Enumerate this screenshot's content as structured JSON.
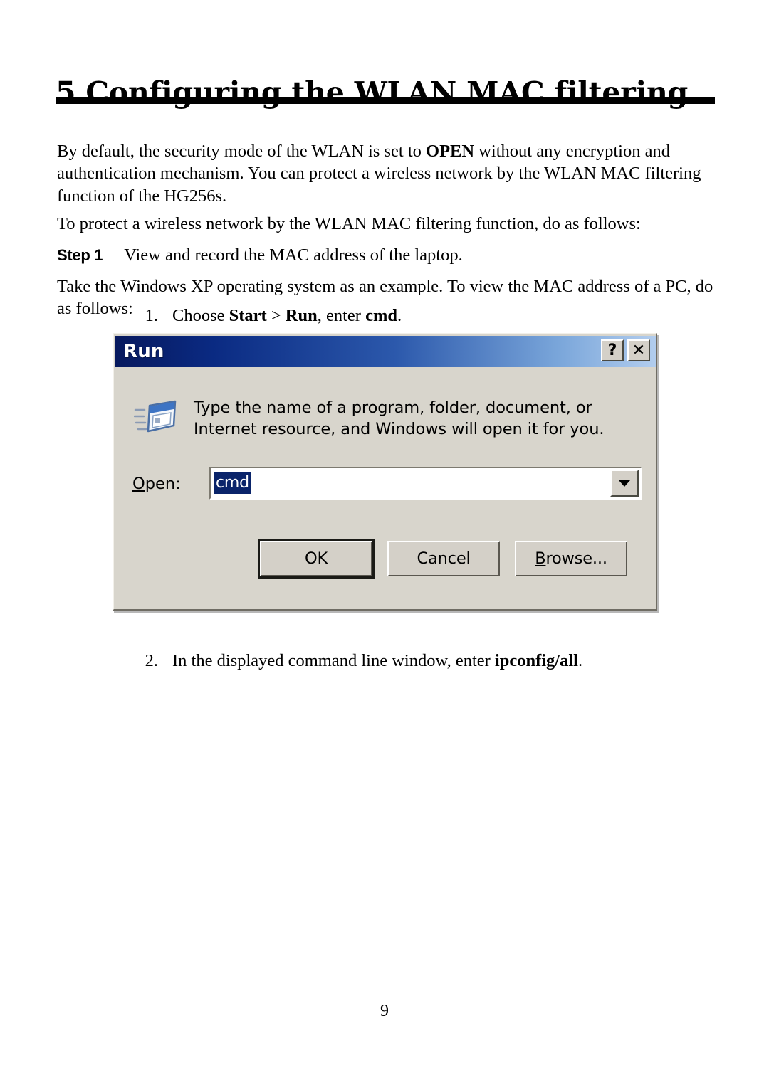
{
  "document": {
    "chapter_title": "5 Configuring the WLAN MAC filtering",
    "page_number": "9"
  },
  "paragraphs": {
    "intro_part1": "By default, the security mode of the WLAN is set to ",
    "intro_open": "OPEN",
    "intro_part2": " without any encryption and authentication mechanism. You can protect a wireless network by the WLAN MAC filtering function of the HG256s.",
    "protect": "To protect a wireless network by the WLAN MAC filtering function, do as follows:",
    "example": "Take the Windows XP operating system as an example. To view the MAC address of a PC, do as follows:"
  },
  "step": {
    "label": "Step 1",
    "text": "View and record the MAC address of the laptop."
  },
  "list_items": [
    {
      "number": "1.",
      "prefix": "Choose ",
      "bold1": "Start",
      "mid": " > ",
      "bold2": "Run",
      "suffix_pre": ", enter ",
      "bold3": "cmd",
      "suffix": "."
    },
    {
      "number": "2.",
      "prefix": "In the displayed command line window, enter ",
      "bold1": "ipconfig/all",
      "suffix": "."
    }
  ],
  "run_dialog": {
    "title": "Run",
    "help_button": "?",
    "close_button": "✕",
    "message_line1": "Type the name of a program, folder, document, or",
    "message_line2": "Internet resource, and Windows will open it for you.",
    "open_label_accel": "O",
    "open_label_rest": "pen:",
    "open_value": "cmd",
    "buttons": {
      "ok": "OK",
      "cancel": "Cancel",
      "browse_accel": "B",
      "browse_rest": "rowse..."
    },
    "colors": {
      "titlebar_start": "#07195e",
      "titlebar_end": "#b2cdee",
      "dialog_face": "#d8d5cc",
      "selection": "#0a246a"
    }
  }
}
